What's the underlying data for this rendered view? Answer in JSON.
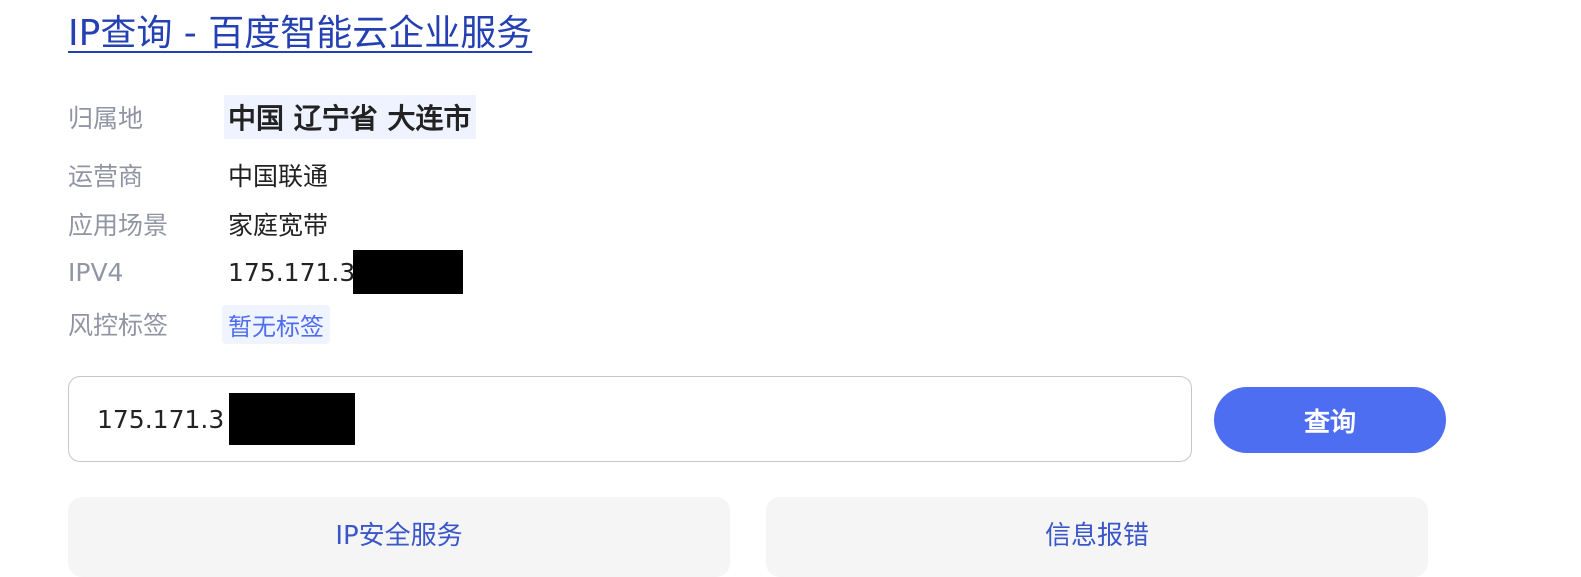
{
  "title": "IP查询 - 百度智能云企业服务",
  "info": {
    "location_label": "归属地",
    "location_value": "中国 辽宁省 大连市",
    "isp_label": "运营商",
    "isp_value": "中国联通",
    "scene_label": "应用场景",
    "scene_value": "家庭宽带",
    "ipv4_label": "IPV4",
    "ipv4_value": "175.171.3",
    "risk_label": "风控标签",
    "risk_value": "暂无标签"
  },
  "search": {
    "value": "175.171.3",
    "button_label": "查询"
  },
  "actions": {
    "security_label": "IP安全服务",
    "report_label": "信息报错"
  },
  "colors": {
    "link": "#2440b3",
    "primary": "#4e6ef2",
    "label": "#9195a3",
    "tag_bg": "#f0f4ff",
    "button_bg": "#f5f5f6"
  }
}
